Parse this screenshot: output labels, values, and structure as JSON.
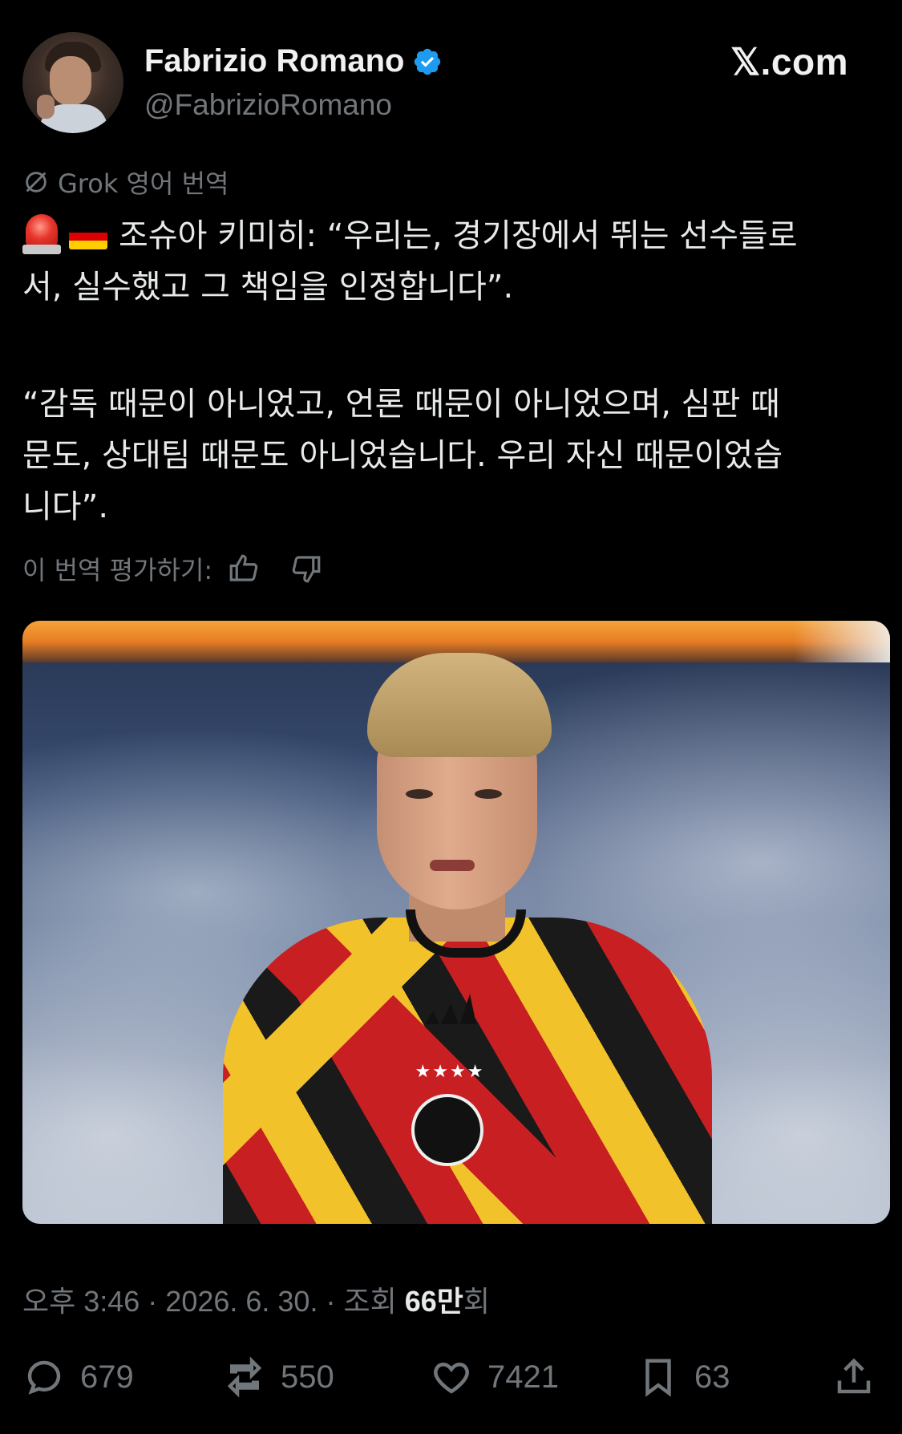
{
  "author": {
    "name": "Fabrizio Romano",
    "handle": "@FabrizioRomano",
    "verified": true
  },
  "site": "𝕏.com",
  "translation": {
    "label": "Grok 영어 번역",
    "rate_label": "이 번역 평가하기:"
  },
  "post": {
    "line1": "조슈아 키미히: “우리는, 경기장에서 뛰는 선수들로",
    "line2": "서, 실수했고 그 책임을 인정합니다”.",
    "para2_line1": "“감독 때문이 아니었고, 언론 때문이 아니었으며, 심판 때",
    "para2_line2": "문도, 상대팀 때문도 아니었습니다. 우리 자신 때문이었습",
    "para2_line3": "니다”.",
    "emoji": [
      "siren-emoji",
      "germany-flag-emoji"
    ]
  },
  "meta": {
    "time": "오후 3:46 · 2026. 6. 30. · 조회 ",
    "views": "66만",
    "views_suffix": "회"
  },
  "actions": {
    "replies": "679",
    "reposts": "550",
    "likes": "7421",
    "bookmarks": "63"
  },
  "colors": {
    "background": "#000000",
    "text": "#e7e9ea",
    "muted": "#71767b",
    "verified": "#1d9bf0"
  },
  "icons": [
    "verified-badge-icon",
    "grok-icon",
    "thumbs-up-icon",
    "thumbs-down-icon",
    "reply-icon",
    "repost-icon",
    "like-icon",
    "bookmark-icon",
    "share-icon"
  ]
}
